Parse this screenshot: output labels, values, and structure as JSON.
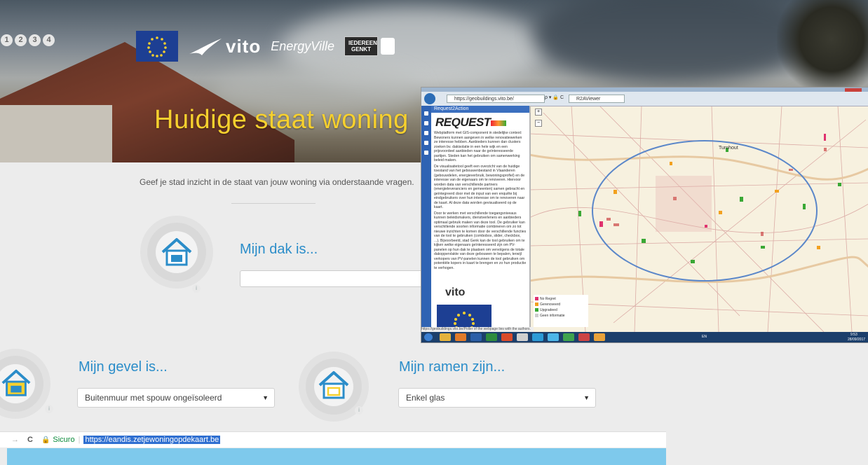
{
  "hero": {
    "steps": [
      "1",
      "2",
      "3",
      "4"
    ],
    "logos": {
      "vito": "vito",
      "energyville": "EnergyVille",
      "genk": "IEDEREEN GENKT"
    },
    "title": "Huidige staat woning"
  },
  "intro": "Geef je stad inzicht in de staat van jouw woning via onderstaande vragen.",
  "questions": {
    "roof": {
      "label": "Mijn dak is...",
      "value": ""
    },
    "facade": {
      "label": "Mijn gevel is...",
      "value": "Buitenmuur met spouw ongeïsoleerd"
    },
    "windows": {
      "label": "Mijn ramen zijn...",
      "value": "Enkel glas"
    }
  },
  "address_bar": {
    "back": "→",
    "reload": "C",
    "secure_label": "Sicuro",
    "url": "https://eandis.zetjewoningopdekaart.be"
  },
  "map_window": {
    "url": "https://geobuildings.vito.be/",
    "search": "ρ ▾ 🔒 C",
    "tab": "R2AViewer",
    "panel_title": "Request2Action",
    "brand": "REQUEST",
    "text1": "Webplatform met GIS-component in stedelijke context: Bewoners kunnen aangeven in welke renovatiewerken ze interesse hebben. Aanbieders kunnen dan clusters zoeken bv. dakisolatie in een hele wijk en een prijsvoordeel aanbieden naar de geïnteresseerde partijen. Steden kan het gebruiken om samenwerking beleid maken.",
    "text2": "De visualisatietool geeft een overzicht van de huidige toestand van het gebouwenbestand in Vlaanderen (gebouwdelen, energieverbruik, bewoningsprofiel) en de interesse van de eigenaars om te renoveren. Hiervoor worden data van verschillende partners (energieleveranciers en gemeenten) samen gebracht en geïntegreerd door met de input van een enquête bij eindgebruikers over hun interesse om te renoveren naar de kaart. Al deze data worden gevisualiseerd op de kaart.",
    "text3": "Door te werken met verschillende toegangsniveaus kunnen beleidsmakers, dienstverleners en aanbieders optimaal gebruik maken van deze tool. De gebruiker kan verschillende soorten informatie combineren om zo tot nieuwe inzichten te komen door de verschillende functies van de tool te gebruiken (combobox, slider, checkbox, ...). Bijvoorbeeld, stad Genk kan de tool gebruiken om te kijken welke eigenaars geïnteresseerd zijn om PV-panelen op hun dak te plaatsen om vervolgens de totale dakoppervlakte van deze gebouwen te bepalen, terwijl verkopers van PV-panelen kunnen de tool gebruiken om potentiële kopers in kaart te brengen en zo hun productie te verhogen.",
    "vito": "vito",
    "town_label": "Turnhout",
    "legend": [
      {
        "label": "No Regret",
        "color": "#e0326e"
      },
      {
        "label": "Gerenoveerd",
        "color": "#f2a11f"
      },
      {
        "label": "Upgradeed",
        "color": "#3aa835"
      },
      {
        "label": "Geen informatie",
        "color": "#cccccc"
      }
    ],
    "status": "https://geobuildings.vito.be/Poller",
    "status_note": "of the webpage lies with the authors. It does not reflect the opinion of the European Union. Neither the",
    "tray_time": "9:53",
    "tray_date": "28/09/2017",
    "tray_lang": "EN"
  }
}
